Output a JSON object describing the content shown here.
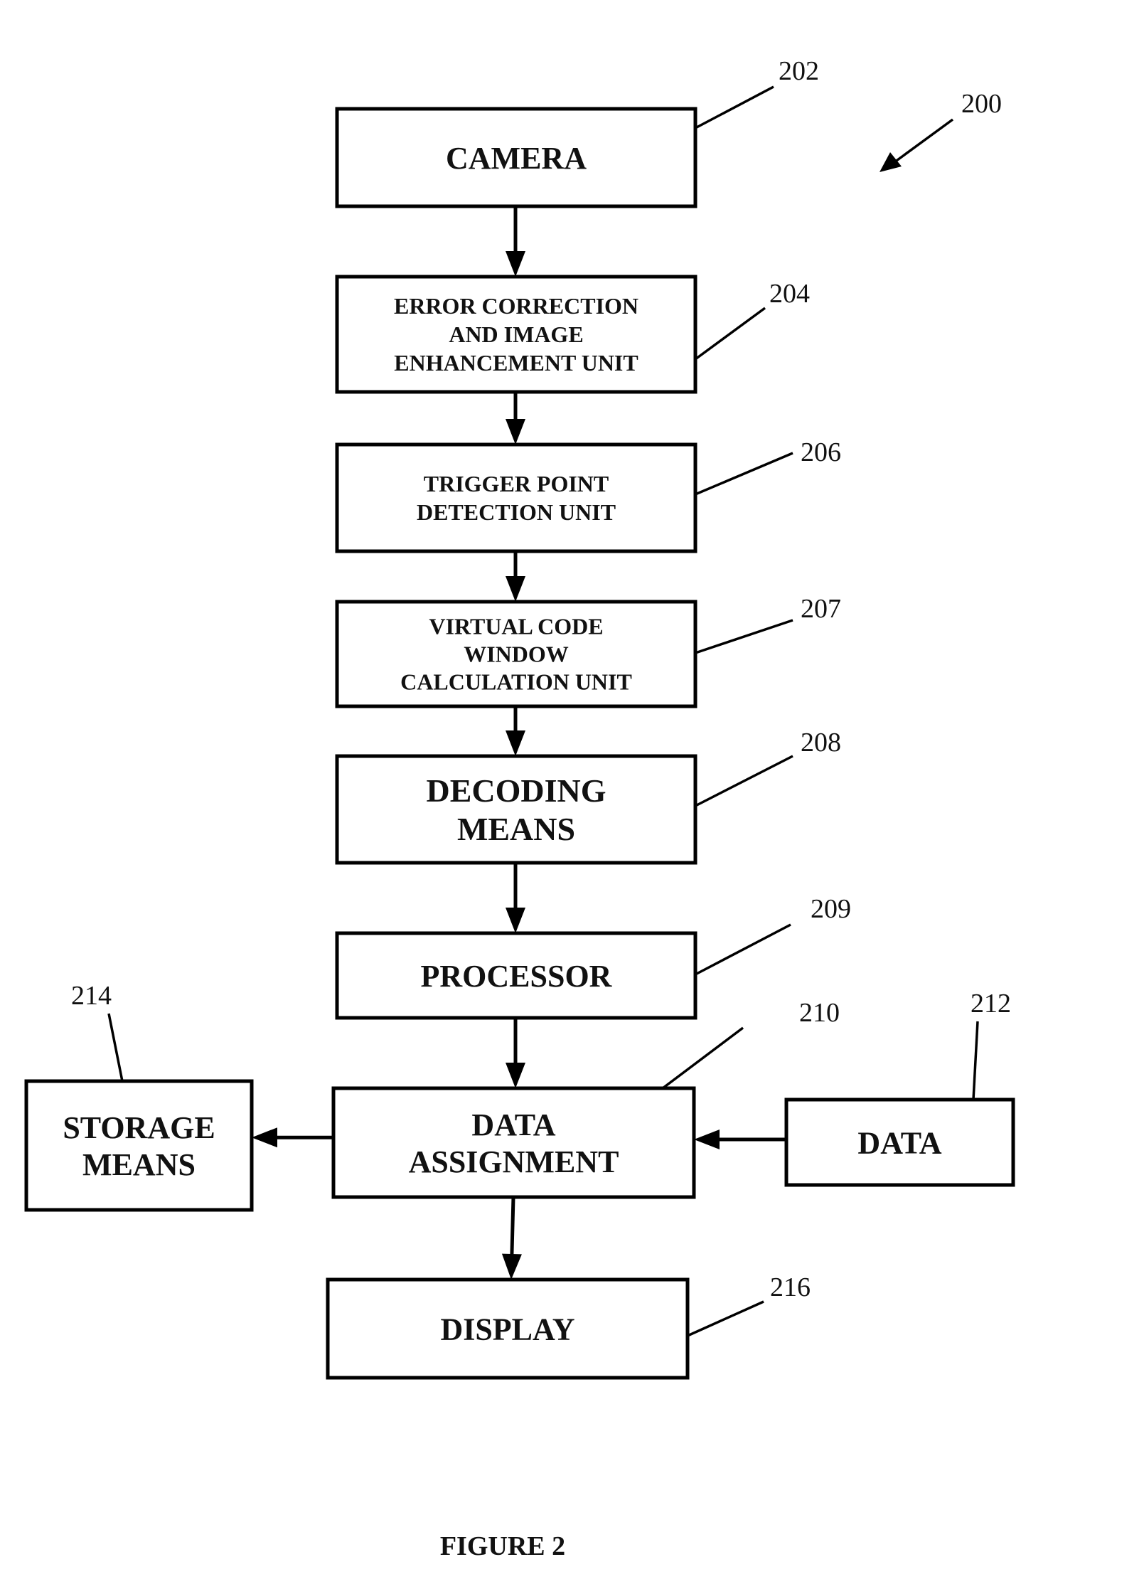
{
  "figure": {
    "caption": "FIGURE 2",
    "system_ref": "200"
  },
  "blocks": [
    {
      "id": "camera",
      "ref": "202",
      "lines": [
        "CAMERA"
      ]
    },
    {
      "id": "error-correction",
      "ref": "204",
      "lines": [
        "ERROR CORRECTION",
        "AND IMAGE",
        "ENHANCEMENT UNIT"
      ]
    },
    {
      "id": "trigger-point",
      "ref": "206",
      "lines": [
        "TRIGGER POINT",
        "DETECTION UNIT"
      ]
    },
    {
      "id": "virtual-code-window",
      "ref": "207",
      "lines": [
        "VIRTUAL CODE",
        "WINDOW",
        "CALCULATION UNIT"
      ]
    },
    {
      "id": "decoding-means",
      "ref": "208",
      "lines": [
        "DECODING",
        "MEANS"
      ]
    },
    {
      "id": "processor",
      "ref": "209",
      "lines": [
        "PROCESSOR"
      ]
    },
    {
      "id": "data-assignment",
      "ref": "210",
      "lines": [
        "DATA",
        "ASSIGNMENT"
      ]
    },
    {
      "id": "data",
      "ref": "212",
      "lines": [
        "DATA"
      ]
    },
    {
      "id": "storage-means",
      "ref": "214",
      "lines": [
        "STORAGE",
        "MEANS"
      ]
    },
    {
      "id": "display",
      "ref": "216",
      "lines": [
        "DISPLAY"
      ]
    }
  ],
  "connections": [
    {
      "from": "camera",
      "to": "error-correction"
    },
    {
      "from": "error-correction",
      "to": "trigger-point"
    },
    {
      "from": "trigger-point",
      "to": "virtual-code-window"
    },
    {
      "from": "virtual-code-window",
      "to": "decoding-means"
    },
    {
      "from": "decoding-means",
      "to": "processor"
    },
    {
      "from": "processor",
      "to": "data-assignment"
    },
    {
      "from": "data",
      "to": "data-assignment"
    },
    {
      "from": "data-assignment",
      "to": "storage-means"
    },
    {
      "from": "data-assignment",
      "to": "display"
    }
  ]
}
